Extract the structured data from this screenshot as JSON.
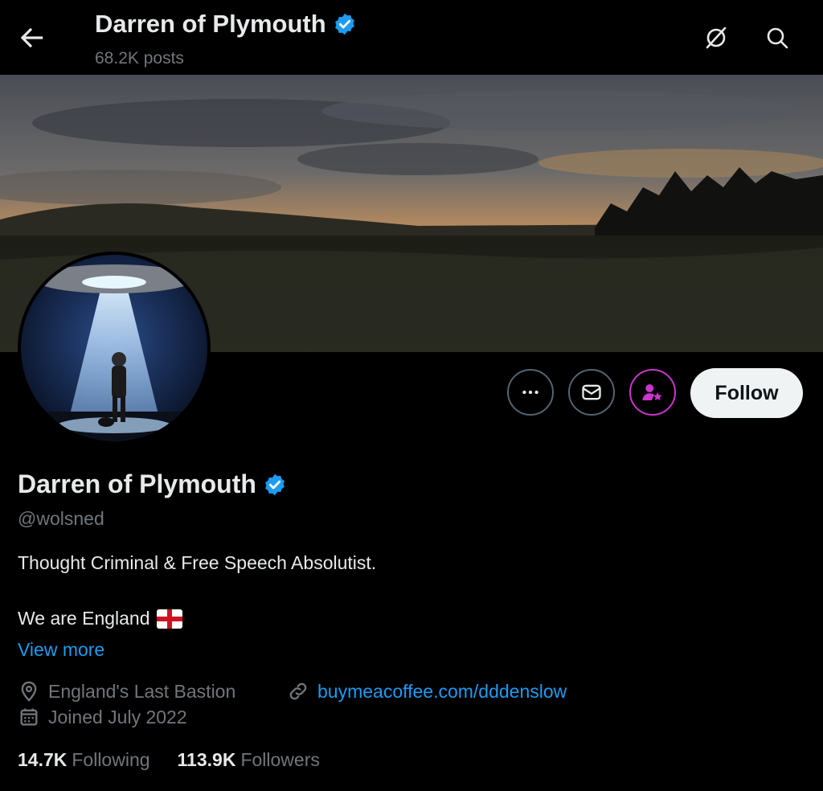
{
  "header": {
    "title": "Darren of Plymouth",
    "posts": "68.2K posts"
  },
  "profile": {
    "name": "Darren of Plymouth",
    "handle": "@wolsned",
    "bio_line1": "Thought Criminal & Free Speech Absolutist.",
    "bio_line2": "We are England",
    "view_more": "View more",
    "location": "England's Last Bastion",
    "website": "buymeacoffee.com/dddenslow",
    "joined": "Joined July 2022",
    "following_count": "14.7K",
    "following_label": "Following",
    "followers_count": "113.9K",
    "followers_label": "Followers"
  },
  "actions": {
    "follow_label": "Follow"
  },
  "icons": {
    "back": "arrow-left-icon",
    "grok": "grok-icon",
    "search": "search-icon",
    "more": "more-icon",
    "message": "mail-icon",
    "subscribe": "subscribe-icon",
    "verified": "verified-badge-icon",
    "location": "location-pin-icon",
    "link": "link-icon",
    "calendar": "calendar-icon",
    "flag": "england-flag-icon"
  },
  "colors": {
    "background": "#000000",
    "text": "#e7e9ea",
    "muted": "#71767b",
    "accent": "#1d9bf0",
    "verified": "#1d9bf0",
    "subscribe": "#c936cc",
    "follow_bg": "#eff3f4"
  }
}
